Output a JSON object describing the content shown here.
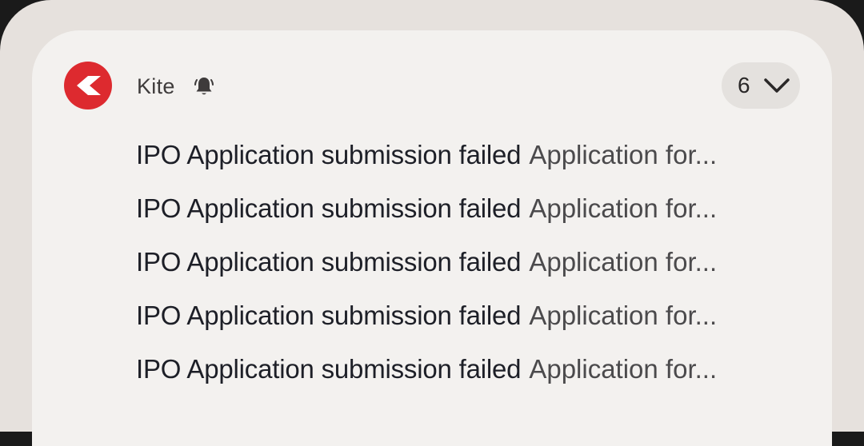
{
  "notification": {
    "app_name": "Kite",
    "icon": "kite-logo-icon",
    "alert_icon": "bell-icon",
    "count": "6",
    "expand_icon": "chevron-down-icon",
    "accent_color": "#dd2a2f",
    "items": [
      {
        "title": "IPO Application submission failed",
        "text": "Application for..."
      },
      {
        "title": "IPO Application submission failed",
        "text": "Application for..."
      },
      {
        "title": "IPO Application submission failed",
        "text": "Application for..."
      },
      {
        "title": "IPO Application submission failed",
        "text": "Application for..."
      },
      {
        "title": "IPO Application submission failed",
        "text": "Application for..."
      }
    ]
  }
}
